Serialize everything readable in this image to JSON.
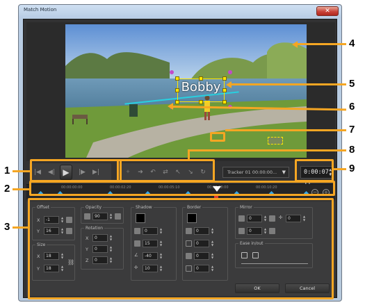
{
  "window": {
    "title": "Match Motion",
    "close_glyph": "✕"
  },
  "video": {
    "tracker_text": "Bobby"
  },
  "controls": {
    "playback_icons": [
      "skip-to-start-icon",
      "step-back-icon",
      "play-icon",
      "step-forward-icon",
      "skip-to-end-icon"
    ],
    "tracker_select": "Tracker 01   00:00:00...",
    "timecode": "0:00:07. 11"
  },
  "timeline": {
    "ticks": [
      "00:00:00:00",
      "00:00:02:20",
      "00:00:05:10",
      "00:00:08:00",
      "00:00:10:20"
    ]
  },
  "properties": {
    "offset": {
      "label": "Offset",
      "x_label": "X",
      "x": "-1",
      "y_label": "Y",
      "y": "16"
    },
    "size": {
      "label": "Size",
      "x_label": "X",
      "x": "18",
      "y_label": "Y",
      "y": "18"
    },
    "opacity": {
      "label": "Opacity",
      "value": "90"
    },
    "rotation": {
      "label": "Rotation",
      "x_label": "X",
      "x": "0",
      "y_label": "Y",
      "y": "0",
      "z_label": "Z",
      "z": "0"
    },
    "shadow": {
      "label": "Shadow",
      "values": [
        "0",
        "15",
        "-40",
        "10"
      ]
    },
    "border": {
      "label": "Border",
      "values": [
        "0",
        "0",
        "0",
        "0"
      ]
    },
    "mirror": {
      "label": "Mirror",
      "values": [
        "0",
        "0",
        "0"
      ]
    },
    "ease": {
      "label": "Ease in/out"
    }
  },
  "buttons": {
    "ok": "OK",
    "cancel": "Cancel"
  },
  "callouts": [
    "1",
    "2",
    "3",
    "4",
    "5",
    "6",
    "7",
    "8",
    "9"
  ],
  "colors": {
    "callout": "#f5a623",
    "tracker_box": "#ffe600",
    "keyframe": "#38a7e6",
    "playhead_marker": "#e33a2f"
  }
}
